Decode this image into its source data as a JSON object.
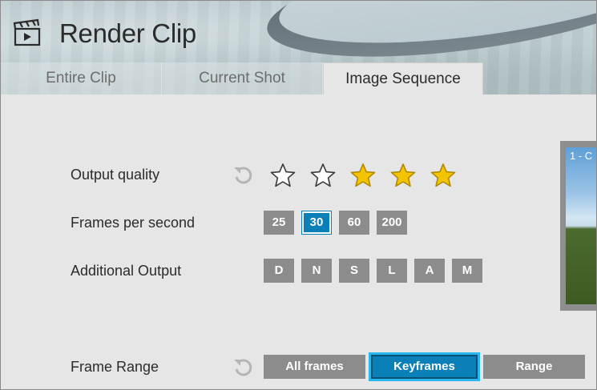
{
  "window": {
    "title": "Render Clip"
  },
  "tabs": [
    {
      "label": "Entire Clip",
      "active": false
    },
    {
      "label": "Current Shot",
      "active": false
    },
    {
      "label": "Image Sequence",
      "active": true
    }
  ],
  "output_quality": {
    "label": "Output quality",
    "rating": 3,
    "max": 5
  },
  "fps": {
    "label": "Frames per second",
    "options": [
      "25",
      "30",
      "60",
      "200"
    ],
    "selected": "30"
  },
  "additional_output": {
    "label": "Additional Output",
    "options": [
      "D",
      "N",
      "S",
      "L",
      "A",
      "M"
    ]
  },
  "frame_range": {
    "label": "Frame Range",
    "options": [
      "All frames",
      "Keyframes",
      "Range"
    ],
    "selected": "Keyframes"
  },
  "preview": {
    "label": "1 - C"
  },
  "colors": {
    "accent": "#0a7fb8",
    "star": "#f5c400",
    "button": "#8c8c8c"
  },
  "icons": [
    "clapperboard-icon",
    "reset-icon",
    "star-icon"
  ]
}
